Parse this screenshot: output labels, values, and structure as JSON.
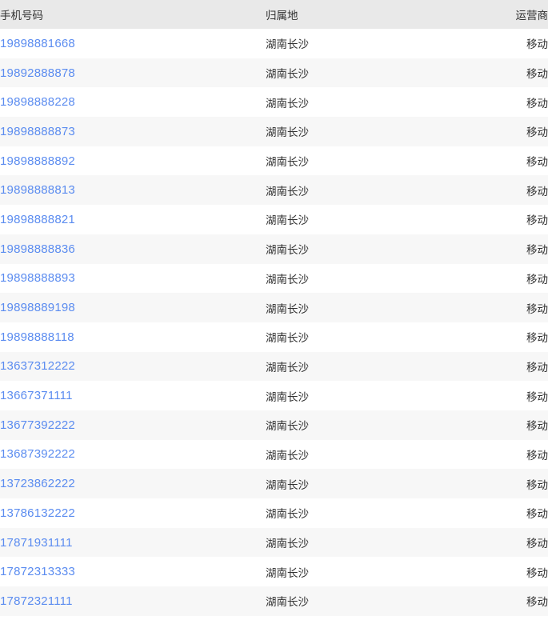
{
  "table": {
    "columns": [
      {
        "key": "number",
        "label": "手机号码"
      },
      {
        "key": "region",
        "label": "归属地"
      },
      {
        "key": "carrier",
        "label": "运营商"
      }
    ],
    "link_color": "#5b8cf0",
    "header_bg": "#e9e9e9",
    "stripe_bg": "#f7f7f7",
    "rows": [
      {
        "number": "19898881668",
        "region": "湖南长沙",
        "carrier": "移动"
      },
      {
        "number": "19892888878",
        "region": "湖南长沙",
        "carrier": "移动"
      },
      {
        "number": "19898888228",
        "region": "湖南长沙",
        "carrier": "移动"
      },
      {
        "number": "19898888873",
        "region": "湖南长沙",
        "carrier": "移动"
      },
      {
        "number": "19898888892",
        "region": "湖南长沙",
        "carrier": "移动"
      },
      {
        "number": "19898888813",
        "region": "湖南长沙",
        "carrier": "移动"
      },
      {
        "number": "19898888821",
        "region": "湖南长沙",
        "carrier": "移动"
      },
      {
        "number": "19898888836",
        "region": "湖南长沙",
        "carrier": "移动"
      },
      {
        "number": "19898888893",
        "region": "湖南长沙",
        "carrier": "移动"
      },
      {
        "number": "19898889198",
        "region": "湖南长沙",
        "carrier": "移动"
      },
      {
        "number": "19898888118",
        "region": "湖南长沙",
        "carrier": "移动"
      },
      {
        "number": "13637312222",
        "region": "湖南长沙",
        "carrier": "移动"
      },
      {
        "number": "13667371111",
        "region": "湖南长沙",
        "carrier": "移动"
      },
      {
        "number": "13677392222",
        "region": "湖南长沙",
        "carrier": "移动"
      },
      {
        "number": "13687392222",
        "region": "湖南长沙",
        "carrier": "移动"
      },
      {
        "number": "13723862222",
        "region": "湖南长沙",
        "carrier": "移动"
      },
      {
        "number": "13786132222",
        "region": "湖南长沙",
        "carrier": "移动"
      },
      {
        "number": "17871931111",
        "region": "湖南长沙",
        "carrier": "移动"
      },
      {
        "number": "17872313333",
        "region": "湖南长沙",
        "carrier": "移动"
      },
      {
        "number": "17872321111",
        "region": "湖南长沙",
        "carrier": "移动"
      }
    ]
  }
}
